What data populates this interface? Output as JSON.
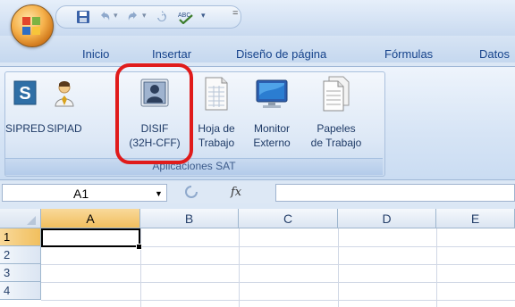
{
  "tabs": [
    "Inicio",
    "Insertar",
    "Diseño de página",
    "Fórmulas",
    "Datos"
  ],
  "group": {
    "label": "Aplicaciones SAT",
    "buttons": [
      {
        "line1": "SIPRED",
        "line2": "",
        "icon": "sipred-s-icon"
      },
      {
        "line1": "SIPIAD",
        "line2": "",
        "icon": "person-tie-icon"
      },
      {
        "line1": "DISIF",
        "line2": "(32H-CFF)",
        "icon": "user-card-icon"
      },
      {
        "line1": "Hoja de",
        "line2": "Trabajo",
        "icon": "worksheet-icon"
      },
      {
        "line1": "Monitor",
        "line2": "Externo",
        "icon": "monitor-icon"
      },
      {
        "line1": "Papeles",
        "line2": "de Trabajo",
        "icon": "papers-icon"
      }
    ]
  },
  "formula_bar": {
    "name_box": "A1",
    "fx": "fx",
    "formula": ""
  },
  "grid": {
    "columns": [
      "A",
      "B",
      "C",
      "D",
      "E"
    ],
    "rows": [
      "1",
      "2",
      "3",
      "4"
    ],
    "active_cell": "A1"
  },
  "colors": {
    "highlight": "#e01b1b",
    "tab_text": "#15428b"
  }
}
